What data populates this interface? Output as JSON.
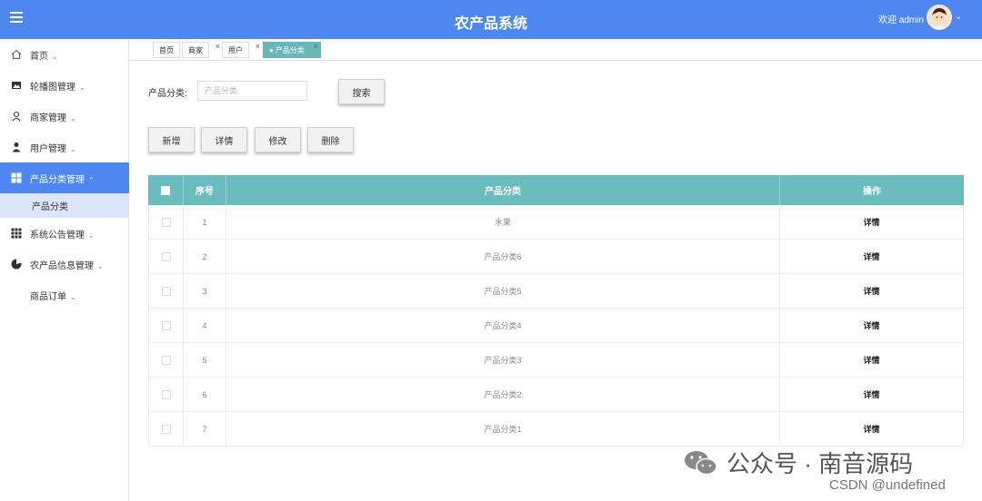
{
  "header": {
    "title": "农产品系统",
    "welcome": "欢迎 admin"
  },
  "sidebar": {
    "items": [
      {
        "label": "首页",
        "icon": "home-icon"
      },
      {
        "label": "轮播图管理",
        "icon": "carousel-icon"
      },
      {
        "label": "商家管理",
        "icon": "merchant-icon"
      },
      {
        "label": "用户管理",
        "icon": "user-icon"
      },
      {
        "label": "产品分类管理",
        "icon": "grid-icon"
      },
      {
        "label": "产品分类"
      },
      {
        "label": "系统公告管理",
        "icon": "apps-icon"
      },
      {
        "label": "农产品信息管理",
        "icon": "pie-icon"
      },
      {
        "label": "商品订单"
      }
    ]
  },
  "tabs": [
    {
      "label": "首页"
    },
    {
      "label": "商家"
    },
    {
      "label": "用户"
    },
    {
      "label": "产品分类"
    }
  ],
  "search": {
    "label": "产品分类:",
    "placeholder": "产品分类",
    "button": "搜索"
  },
  "actions": {
    "add": "新增",
    "detail": "详情",
    "edit": "修改",
    "delete": "删除"
  },
  "table": {
    "headers": {
      "index": "序号",
      "name": "产品分类",
      "op": "操作"
    },
    "rows": [
      {
        "index": "1",
        "name": "水果",
        "op": "详情"
      },
      {
        "index": "2",
        "name": "产品分类6",
        "op": "详情"
      },
      {
        "index": "3",
        "name": "产品分类5",
        "op": "详情"
      },
      {
        "index": "4",
        "name": "产品分类4",
        "op": "详情"
      },
      {
        "index": "5",
        "name": "产品分类3",
        "op": "详情"
      },
      {
        "index": "6",
        "name": "产品分类2",
        "op": "详情"
      },
      {
        "index": "7",
        "name": "产品分类1",
        "op": "详情"
      }
    ]
  },
  "watermark": {
    "text": "公众号 · 南音源码",
    "csdn": "CSDN @undefined"
  },
  "colors": {
    "primary": "#4e87f0",
    "teal": "#6bbcbf",
    "subActive": "#dbe5fb"
  }
}
